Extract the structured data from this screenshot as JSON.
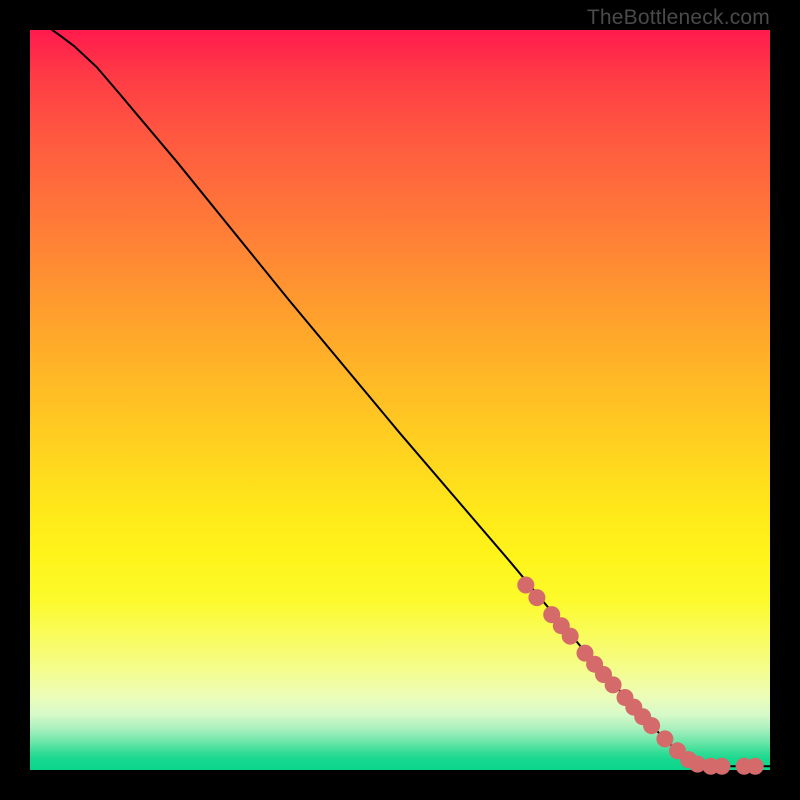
{
  "watermark": "TheBottleneck.com",
  "chart_data": {
    "type": "line",
    "title": "",
    "xlabel": "",
    "ylabel": "",
    "xlim": [
      0,
      100
    ],
    "ylim": [
      0,
      100
    ],
    "grid": false,
    "legend": false,
    "series": [
      {
        "name": "curve",
        "type": "line",
        "points": [
          {
            "x": 3.0,
            "y": 100.0
          },
          {
            "x": 4.0,
            "y": 99.3
          },
          {
            "x": 6.0,
            "y": 97.8
          },
          {
            "x": 9.0,
            "y": 95.0
          },
          {
            "x": 12.0,
            "y": 91.5
          },
          {
            "x": 20.0,
            "y": 82.0
          },
          {
            "x": 35.0,
            "y": 63.5
          },
          {
            "x": 50.0,
            "y": 45.5
          },
          {
            "x": 65.0,
            "y": 28.0
          },
          {
            "x": 75.0,
            "y": 16.0
          },
          {
            "x": 83.0,
            "y": 7.0
          },
          {
            "x": 87.0,
            "y": 3.0
          },
          {
            "x": 89.5,
            "y": 1.2
          },
          {
            "x": 91.5,
            "y": 0.5
          },
          {
            "x": 94.0,
            "y": 0.5
          },
          {
            "x": 100.0,
            "y": 0.5
          }
        ]
      },
      {
        "name": "markers",
        "type": "scatter",
        "points": [
          {
            "x": 67.0,
            "y": 25.0
          },
          {
            "x": 68.5,
            "y": 23.3
          },
          {
            "x": 70.5,
            "y": 21.0
          },
          {
            "x": 71.8,
            "y": 19.5
          },
          {
            "x": 73.0,
            "y": 18.1
          },
          {
            "x": 75.0,
            "y": 15.8
          },
          {
            "x": 76.3,
            "y": 14.3
          },
          {
            "x": 77.5,
            "y": 12.9
          },
          {
            "x": 78.8,
            "y": 11.5
          },
          {
            "x": 80.4,
            "y": 9.8
          },
          {
            "x": 81.6,
            "y": 8.5
          },
          {
            "x": 82.8,
            "y": 7.2
          },
          {
            "x": 84.0,
            "y": 6.0
          },
          {
            "x": 85.8,
            "y": 4.2
          },
          {
            "x": 87.5,
            "y": 2.6
          },
          {
            "x": 89.0,
            "y": 1.4
          },
          {
            "x": 90.2,
            "y": 0.8
          },
          {
            "x": 92.0,
            "y": 0.5
          },
          {
            "x": 93.5,
            "y": 0.5
          },
          {
            "x": 96.5,
            "y": 0.5
          },
          {
            "x": 98.0,
            "y": 0.5
          }
        ]
      }
    ],
    "colors": {
      "curve": "#000000",
      "marker": "#d46a6a",
      "gradient_top": "#ff1a4d",
      "gradient_mid": "#ffe81a",
      "gradient_bottom": "#0ad68b"
    }
  }
}
